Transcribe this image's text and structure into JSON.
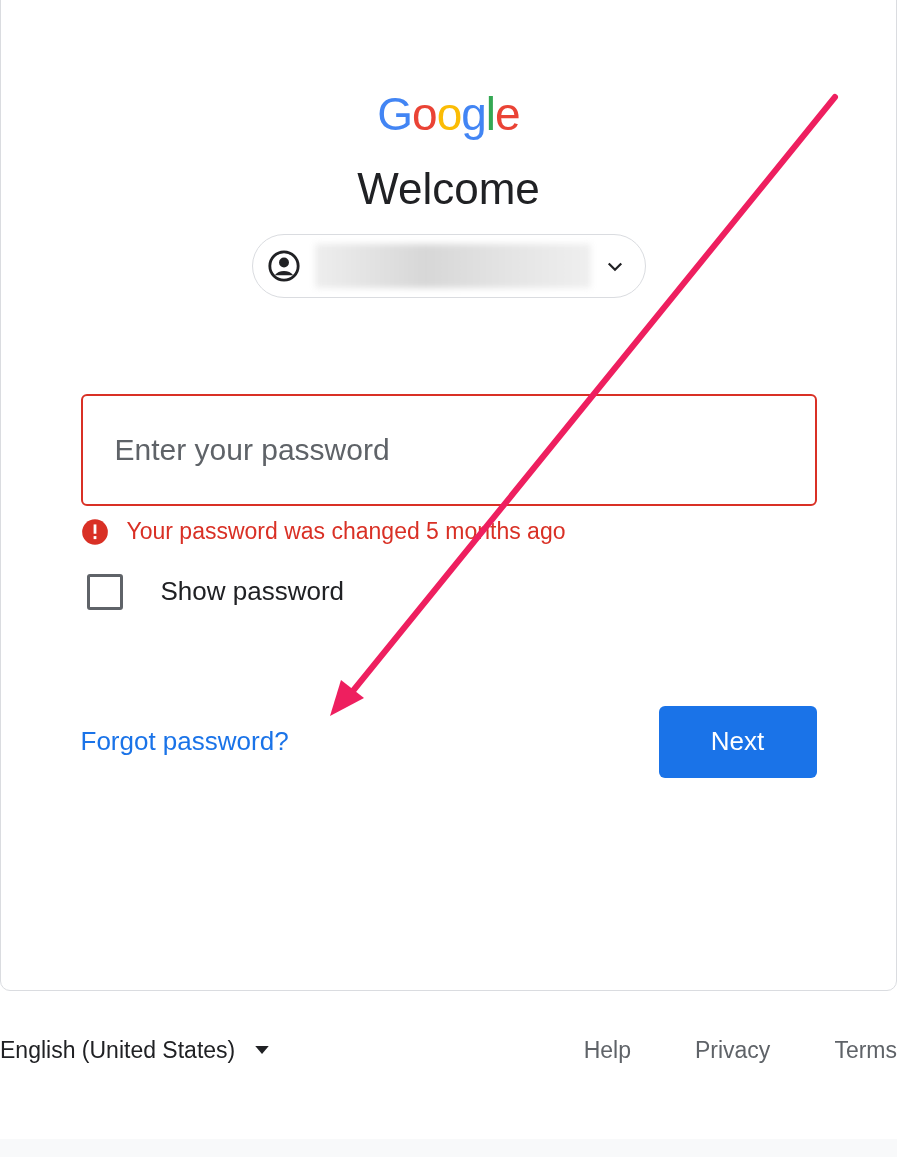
{
  "logo": "Google",
  "title": "Welcome",
  "account_chip": {
    "expanded": false
  },
  "password_field": {
    "placeholder": "Enter your password",
    "error": true
  },
  "error_message": "Your password was changed 5 months ago",
  "show_password": {
    "label": "Show password",
    "checked": false
  },
  "forgot_link": "Forgot password?",
  "next_button": "Next",
  "footer": {
    "language": "English (United States)",
    "links": [
      "Help",
      "Privacy",
      "Terms"
    ]
  }
}
